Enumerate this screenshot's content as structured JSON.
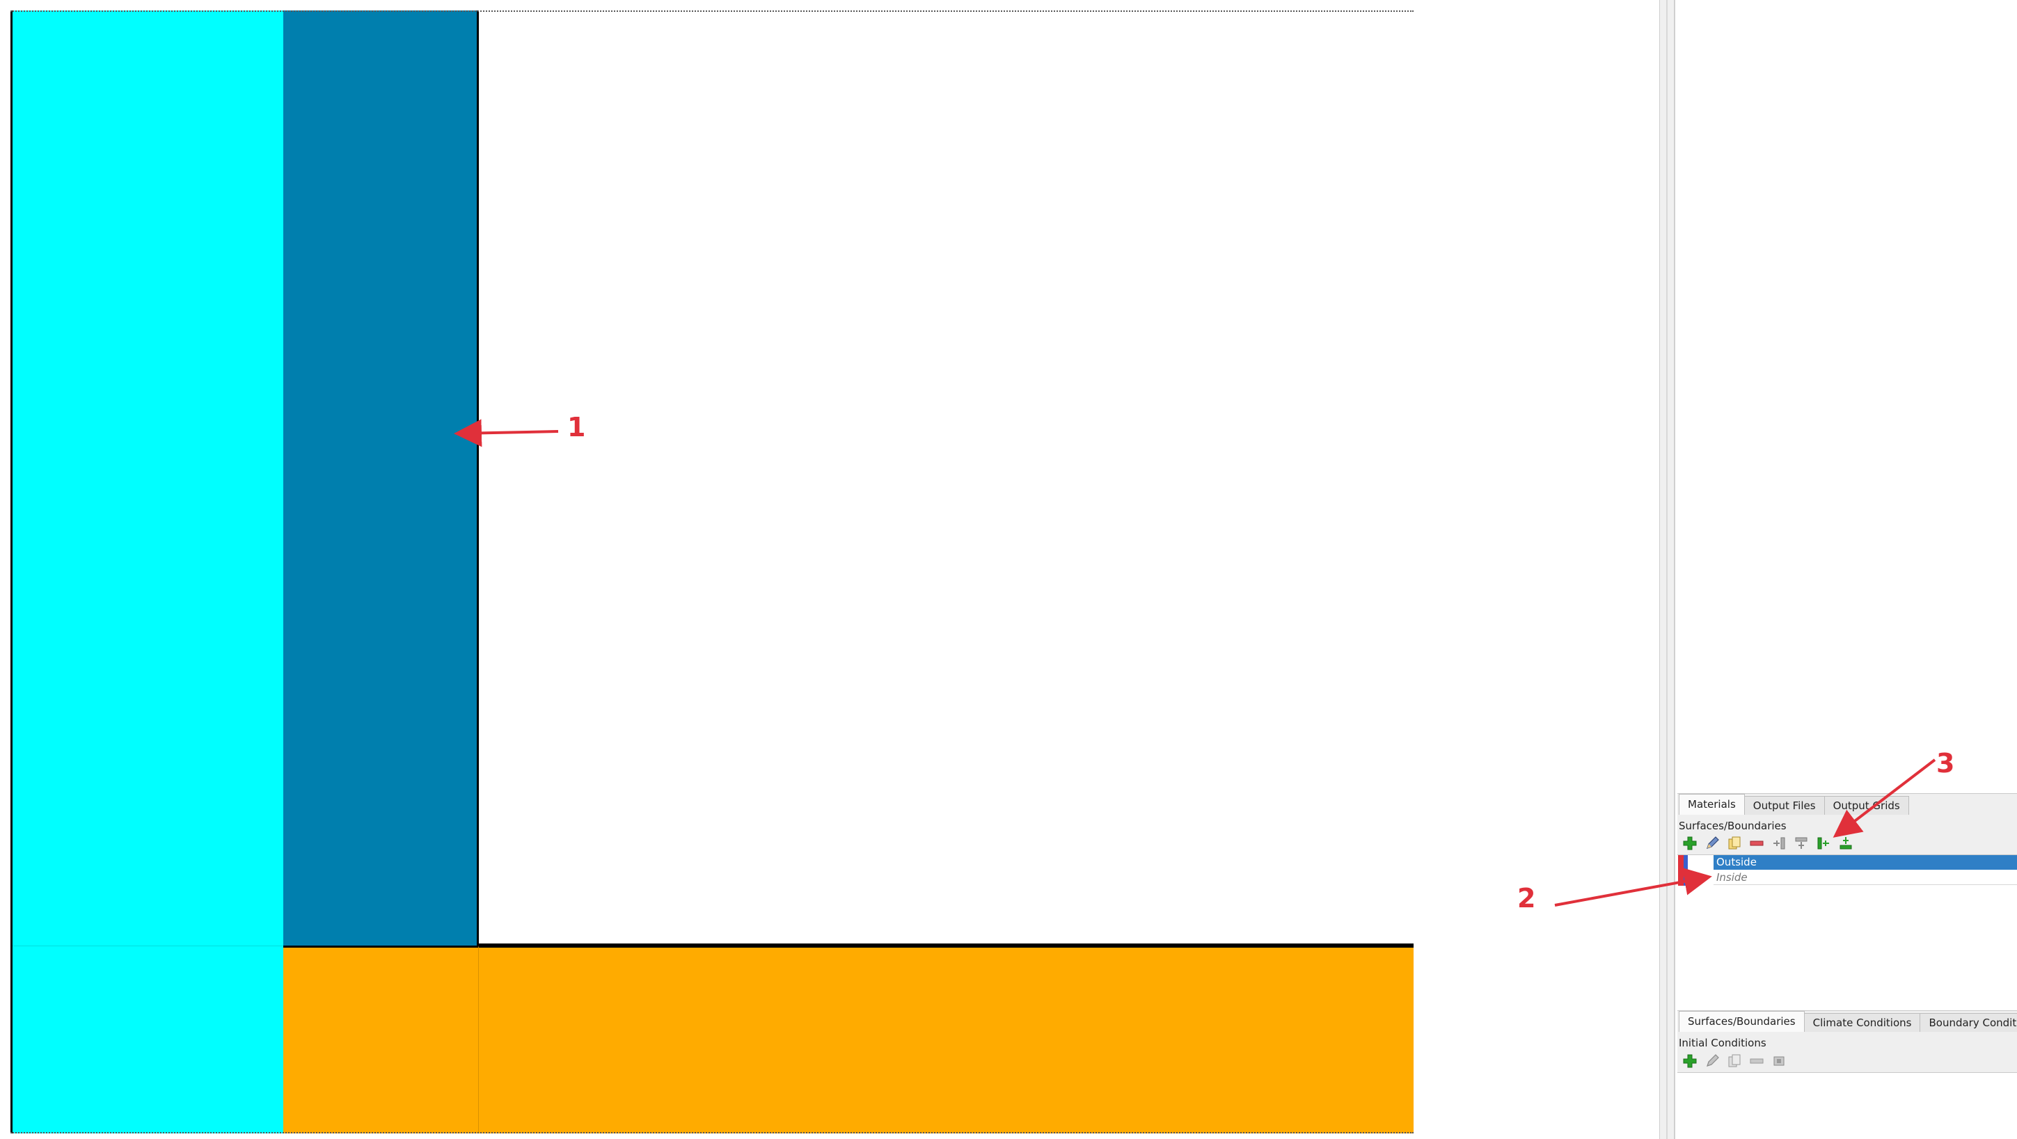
{
  "colors": {
    "cyan": "#00ffff",
    "blue": "#007fae",
    "orange": "#ffab00",
    "white": "#ffffff",
    "selection": "#2f7fc6",
    "annotation": "#e0303a",
    "green_icon": "#2aa12a",
    "red_icon": "#e0505a"
  },
  "top_tabs": [
    {
      "label": "Materials",
      "active": true
    },
    {
      "label": "Output Files",
      "active": false
    },
    {
      "label": "Output Grids",
      "active": false
    }
  ],
  "surfaces_section": {
    "label": "Surfaces/Boundaries",
    "toolbar_icons": [
      "add-icon",
      "edit-icon",
      "copy-icon",
      "remove-icon",
      "assign-left-icon",
      "assign-top-icon",
      "assign-right-icon",
      "assign-bottom-icon"
    ],
    "items": [
      {
        "name": "Outside",
        "selected": true,
        "swatch": "#e0303a"
      },
      {
        "name": "Inside",
        "selected": false,
        "swatch": "#3a5fcd"
      }
    ]
  },
  "bottom_tabs": [
    {
      "label": "Surfaces/Boundaries",
      "active": true
    },
    {
      "label": "Climate Conditions",
      "active": false
    },
    {
      "label": "Boundary Conditions",
      "active": false
    }
  ],
  "initial_conditions_section": {
    "label": "Initial Conditions",
    "toolbar_icons": [
      "add-icon",
      "edit-icon",
      "copy-icon",
      "remove-icon",
      "assign-icon"
    ]
  },
  "annotations": [
    "1",
    "2",
    "3"
  ]
}
